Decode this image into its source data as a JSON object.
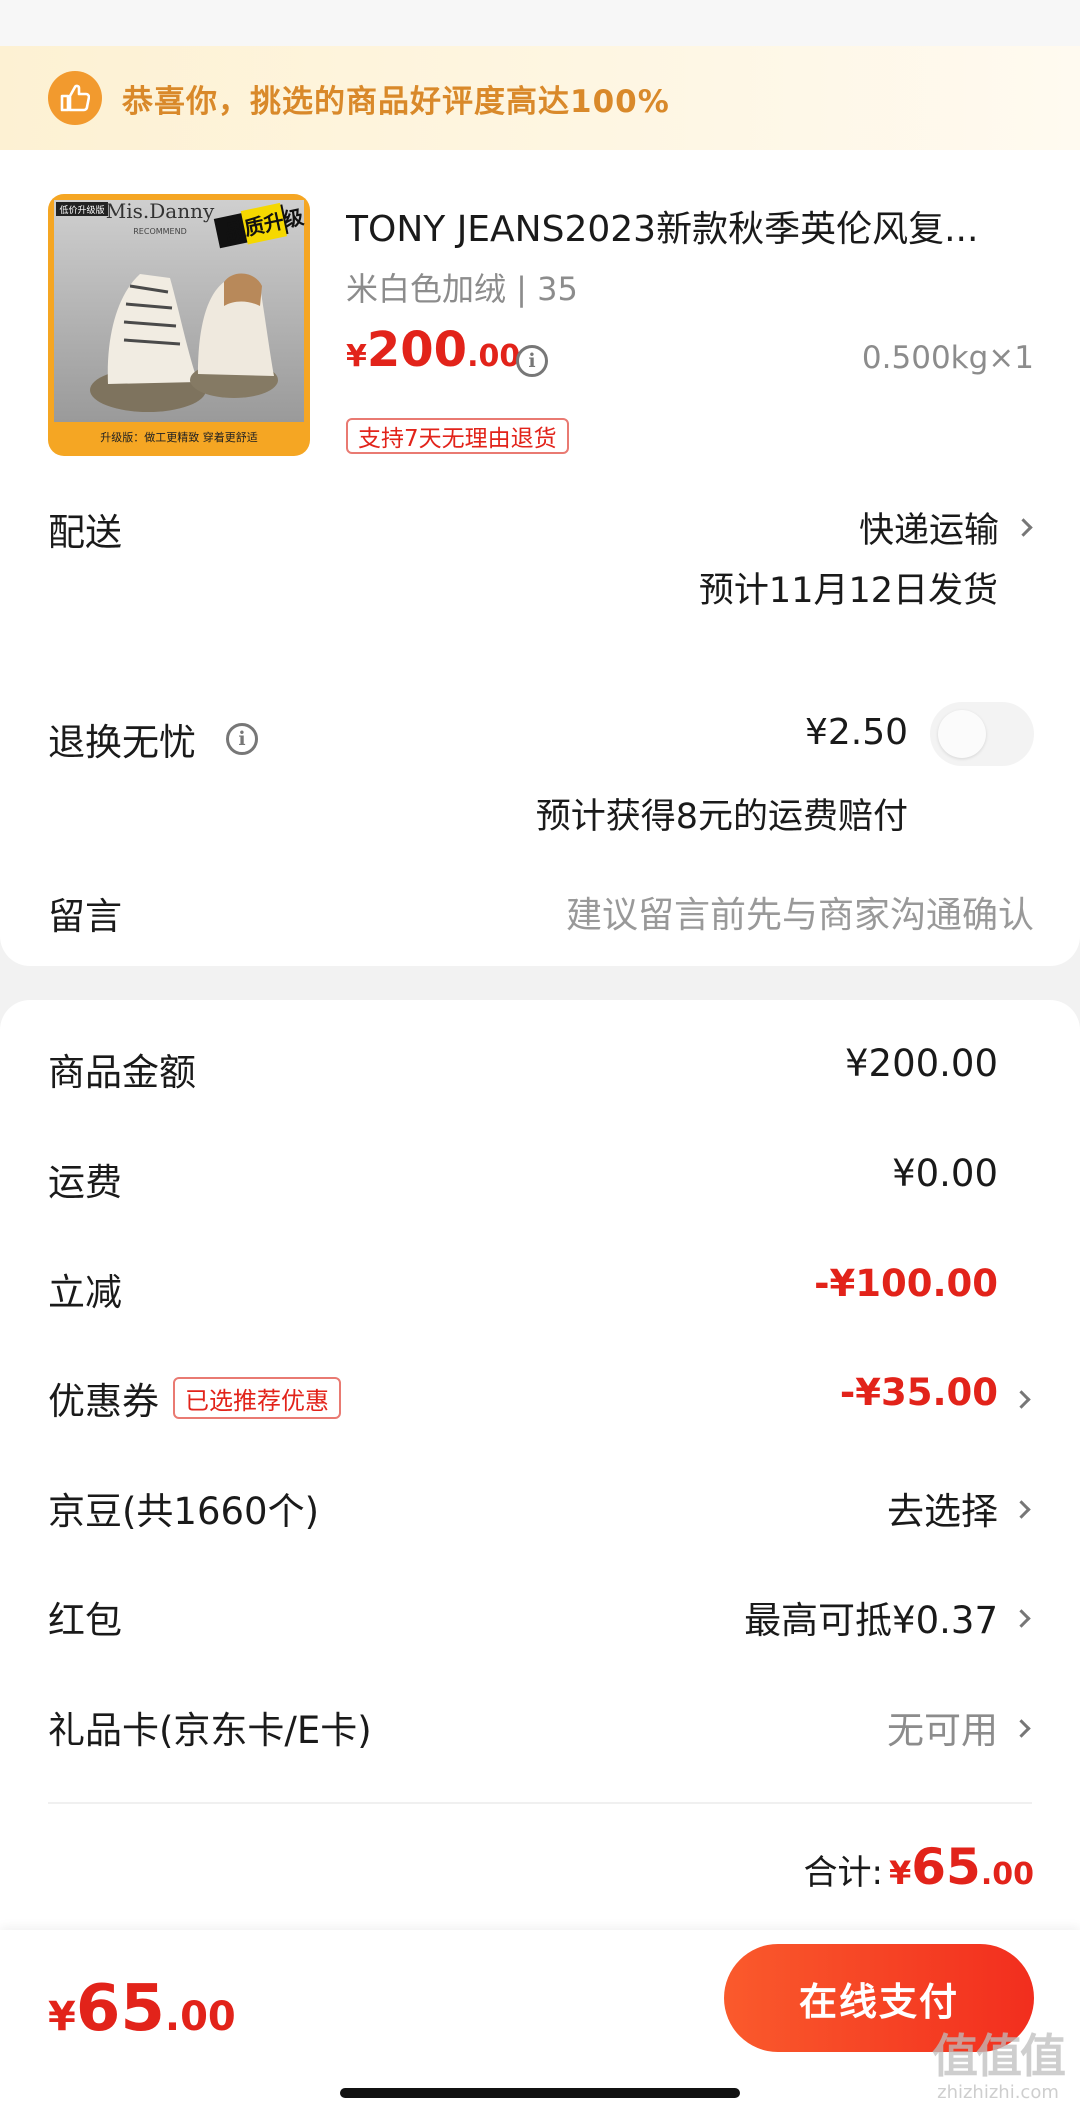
{
  "banner": {
    "icon": "thumbs-up-icon",
    "text": "恭喜你，挑选的商品好评度高达100%"
  },
  "product": {
    "title": "TONY JEANS2023新款秋季英伦风复...",
    "variant": "米白色加绒 | 35",
    "price_currency": "¥",
    "price_int": "200",
    "price_dec": ".00",
    "weight_qty": "0.500kg×1",
    "tag": "支持7天无理由退货",
    "image": {
      "brand": "Mis.Danny",
      "sub": "RECOMMEND",
      "corner_label": "低价升级版",
      "badge": "品质升级",
      "footer": "升级版：做工更精致  穿着更舒适"
    }
  },
  "shipping": {
    "label": "配送",
    "method": "快递运输",
    "date": "预计11月12日发货"
  },
  "return": {
    "label": "退换无忧",
    "price": "¥2.50",
    "note": "预计获得8元的运费赔付",
    "enabled": false
  },
  "message": {
    "label": "留言",
    "placeholder": "建议留言前先与商家沟通确认"
  },
  "summary": [
    {
      "label": "商品金额",
      "value": "¥200.00",
      "style": "normal",
      "chevron": false
    },
    {
      "label": "运费",
      "value": "¥0.00",
      "style": "normal",
      "chevron": false
    },
    {
      "label": "立减",
      "value": "-¥100.00",
      "style": "red",
      "chevron": false
    },
    {
      "label": "优惠券",
      "tag": "已选推荐优惠",
      "value": "-¥35.00",
      "style": "red",
      "chevron": true
    },
    {
      "label": "京豆(共1660个)",
      "value": "去选择",
      "style": "normal",
      "chevron": true
    },
    {
      "label": "红包",
      "value": "最高可抵¥0.37",
      "style": "normal",
      "chevron": true
    },
    {
      "label": "礼品卡(京东卡/E卡)",
      "value": "无可用",
      "style": "gray",
      "chevron": true
    }
  ],
  "total": {
    "label": "合计:",
    "currency": "¥",
    "int": "65",
    "dec": ".00"
  },
  "bottom": {
    "currency": "¥",
    "int": "65",
    "dec": ".00",
    "pay_label": "在线支付"
  },
  "watermark": {
    "logo": "值值值",
    "url": "zhizhizhi.com"
  },
  "colors": {
    "accent": "#e2231a",
    "banner_text": "#d9892a",
    "pay_button": "#f22e1e"
  }
}
